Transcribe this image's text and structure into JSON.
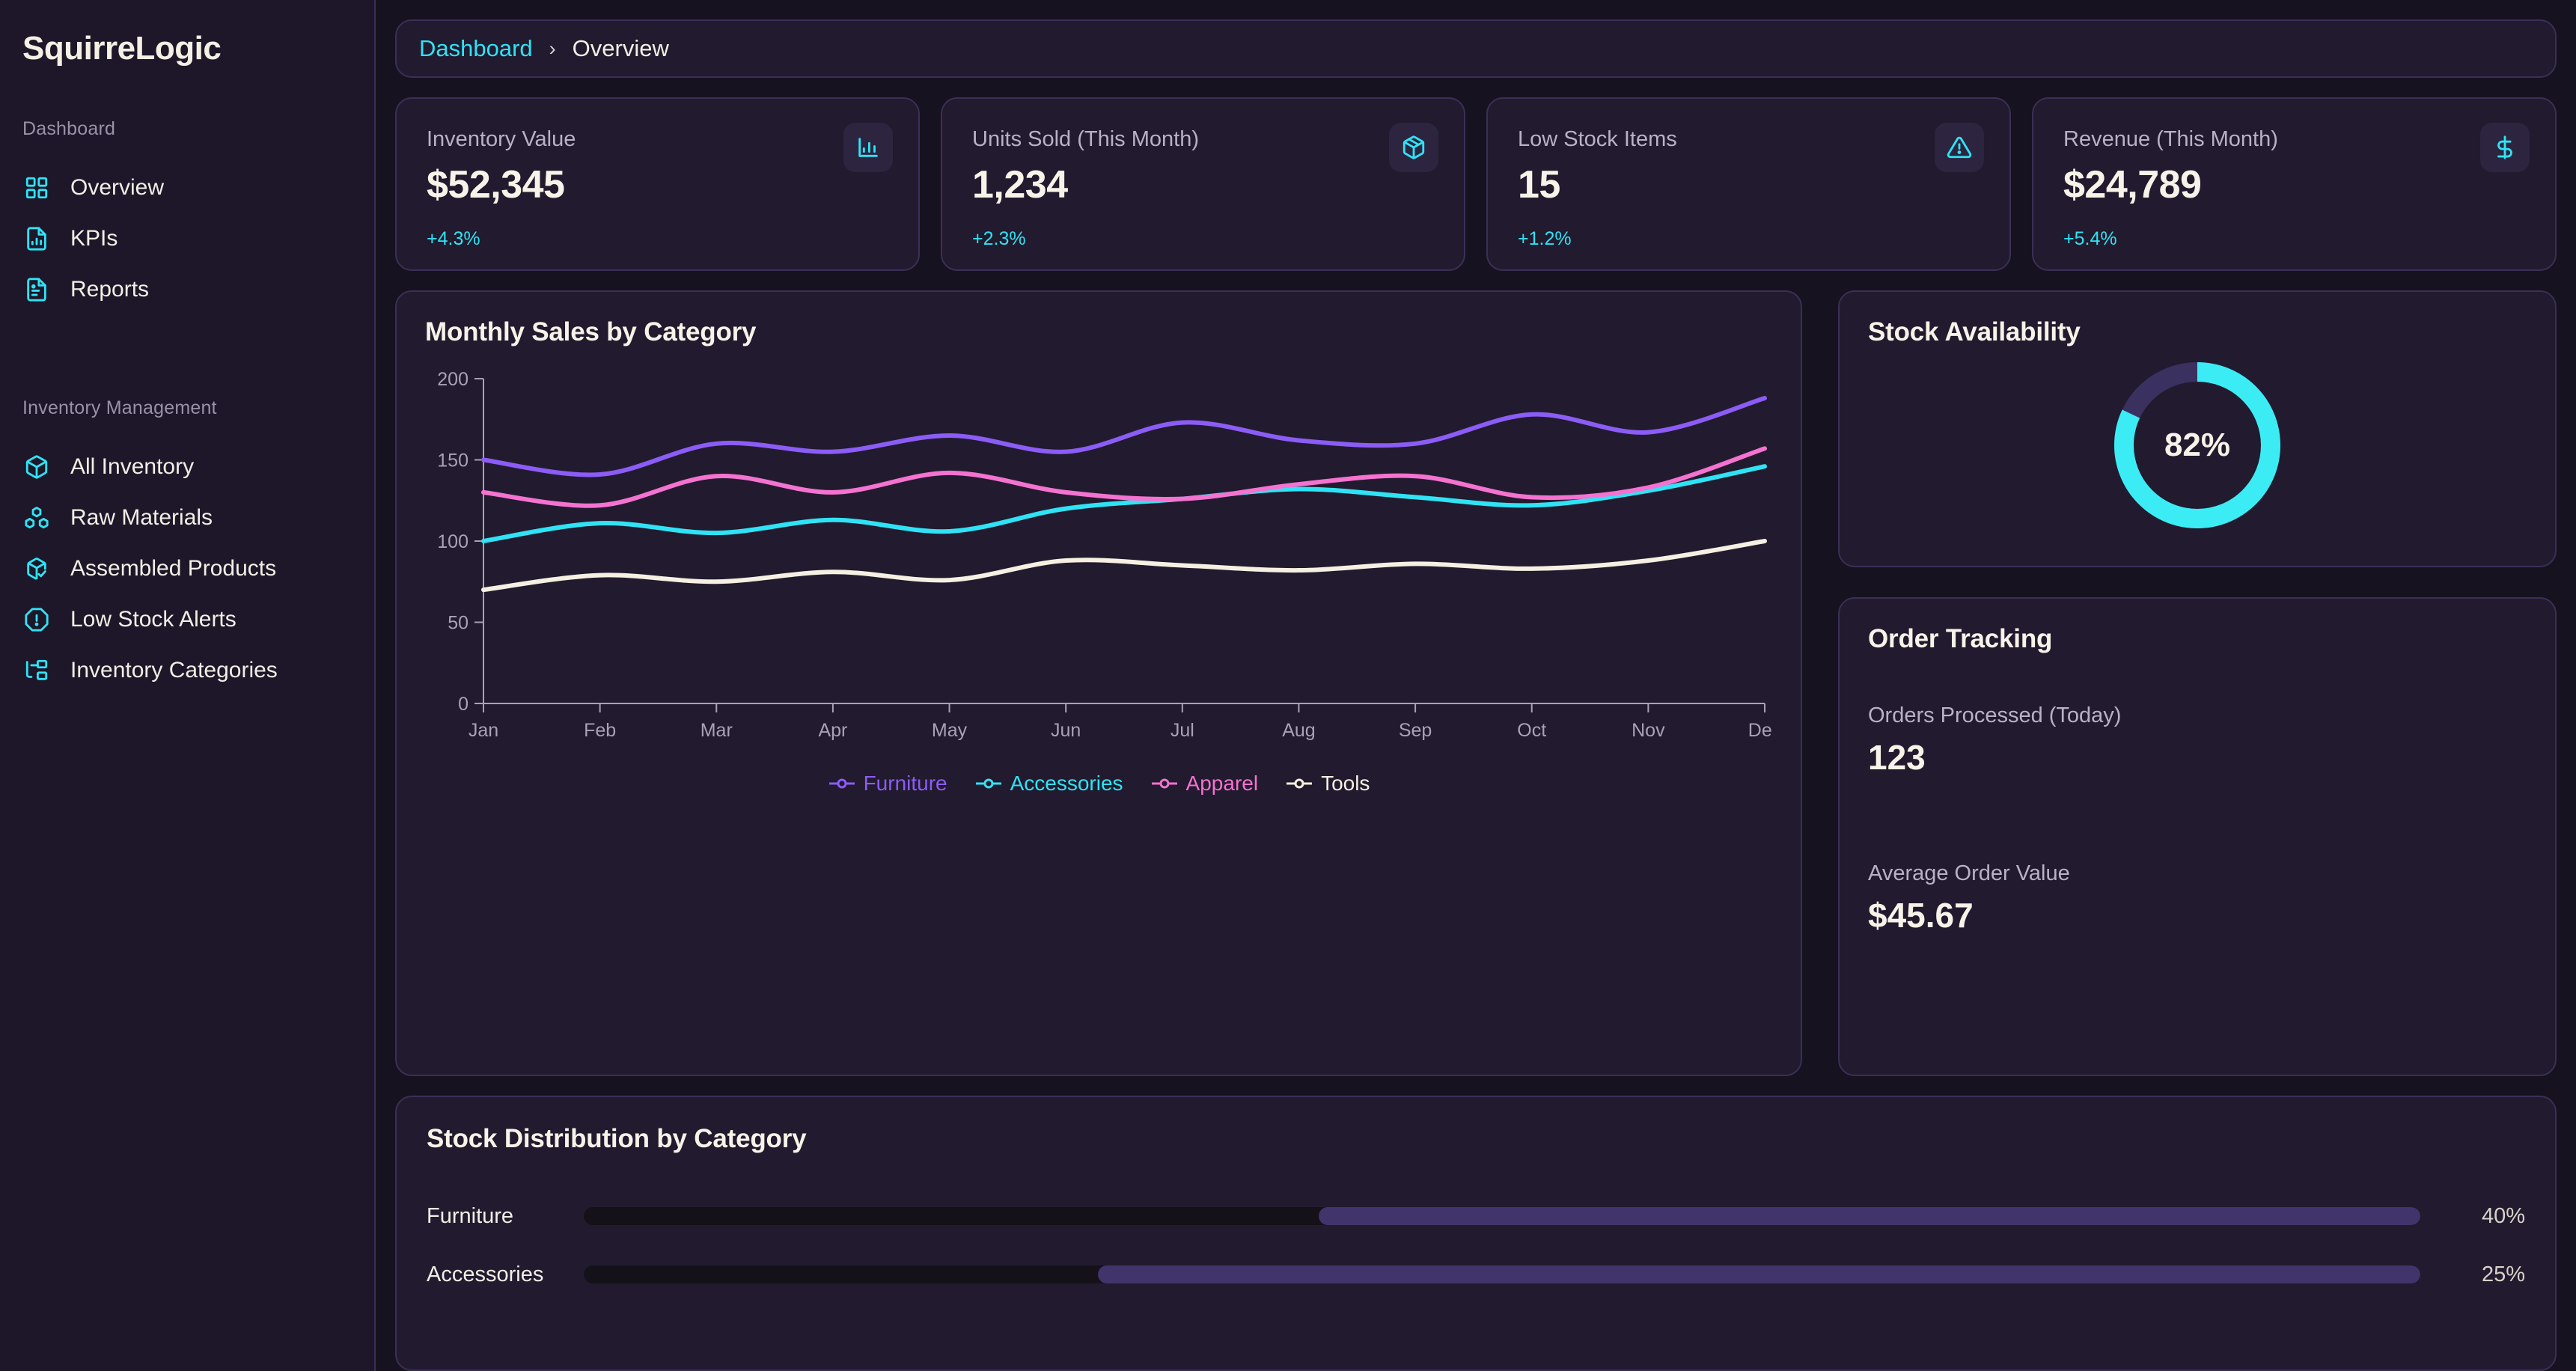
{
  "brand": "SquirreLogic",
  "sidebar": {
    "groups": [
      {
        "heading": "Dashboard",
        "items": [
          {
            "label": "Overview",
            "icon": "grid-icon"
          },
          {
            "label": "KPIs",
            "icon": "file-chart-icon"
          },
          {
            "label": "Reports",
            "icon": "file-text-icon"
          }
        ]
      },
      {
        "heading": "Inventory Management",
        "items": [
          {
            "label": "All Inventory",
            "icon": "box-icon"
          },
          {
            "label": "Raw Materials",
            "icon": "boxes-icon"
          },
          {
            "label": "Assembled Products",
            "icon": "package-check-icon"
          },
          {
            "label": "Low Stock Alerts",
            "icon": "alert-octagon-icon"
          },
          {
            "label": "Inventory Categories",
            "icon": "folder-tree-icon"
          }
        ]
      }
    ]
  },
  "breadcrumb": {
    "root": "Dashboard",
    "separator": "›",
    "current": "Overview"
  },
  "kpis": [
    {
      "label": "Inventory Value",
      "value": "$52,345",
      "delta": "+4.3%",
      "icon": "bar-chart-icon"
    },
    {
      "label": "Units Sold (This Month)",
      "value": "1,234",
      "delta": "+2.3%",
      "icon": "package-icon"
    },
    {
      "label": "Low Stock Items",
      "value": "15",
      "delta": "+1.2%",
      "icon": "alert-triangle-icon"
    },
    {
      "label": "Revenue (This Month)",
      "value": "$24,789",
      "delta": "+5.4%",
      "icon": "dollar-icon"
    }
  ],
  "stock_availability": {
    "title": "Stock Availability",
    "percent_label": "82%",
    "percent": 82,
    "filled_color": "#3cecf5",
    "track_color": "#3b3160"
  },
  "order_tracking": {
    "title": "Order Tracking",
    "metrics": [
      {
        "label": "Orders Processed (Today)",
        "value": "123"
      },
      {
        "label": "Average Order Value",
        "value": "$45.67"
      }
    ]
  },
  "stock_distribution": {
    "title": "Stock Distribution by Category",
    "rows": [
      {
        "name": "Furniture",
        "percent_label": "40%",
        "percent": 60
      },
      {
        "name": "Accessories",
        "percent_label": "25%",
        "percent": 72
      }
    ],
    "fill_color": "#40346b",
    "track_color": "#141118"
  },
  "chart_data": {
    "type": "line",
    "title": "Monthly Sales by Category",
    "xlabel": "",
    "ylabel": "",
    "x": [
      "Jan",
      "Feb",
      "Mar",
      "Apr",
      "May",
      "Jun",
      "Jul",
      "Aug",
      "Sep",
      "Oct",
      "Nov",
      "Dec"
    ],
    "xticks": [
      "Jan",
      "Feb",
      "Mar",
      "Apr",
      "May",
      "Jun",
      "Jul",
      "Aug",
      "Sep",
      "Oct",
      "Nov",
      "Dec"
    ],
    "yticks": [
      0,
      50,
      100,
      150,
      200
    ],
    "ylim": [
      0,
      200
    ],
    "grid": false,
    "legend_position": "bottom",
    "series": [
      {
        "name": "Furniture",
        "color": "#8b5cf6",
        "values": [
          150,
          141,
          160,
          155,
          165,
          155,
          173,
          162,
          160,
          178,
          167,
          188
        ]
      },
      {
        "name": "Accessories",
        "color": "#2fe3f5",
        "values": [
          100,
          111,
          105,
          113,
          106,
          120,
          126,
          132,
          127,
          122,
          131,
          146
        ]
      },
      {
        "name": "Apparel",
        "color": "#f472d0",
        "values": [
          130,
          122,
          140,
          130,
          142,
          130,
          126,
          135,
          140,
          127,
          133,
          157
        ]
      },
      {
        "name": "Tools",
        "color": "#f5f0e1",
        "values": [
          70,
          79,
          75,
          81,
          76,
          88,
          85,
          82,
          86,
          83,
          88,
          100
        ]
      }
    ]
  }
}
